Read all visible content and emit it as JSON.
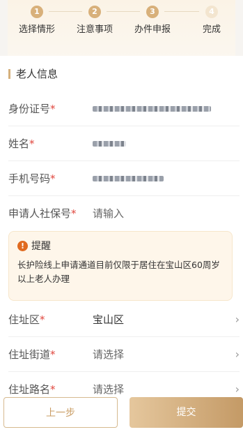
{
  "steps": [
    {
      "num": "1",
      "label": "选择情形"
    },
    {
      "num": "2",
      "label": "注意事项"
    },
    {
      "num": "3",
      "label": "办件申报"
    },
    {
      "num": "4",
      "label": "完成"
    }
  ],
  "section": {
    "title": "老人信息"
  },
  "fields": [
    {
      "label": "身份证号",
      "required_mark": "*",
      "value": ""
    },
    {
      "label": "姓名",
      "required_mark": "*",
      "value": ""
    },
    {
      "label": "手机号码",
      "required_mark": "*",
      "value": ""
    },
    {
      "label": "申请人社保号",
      "required_mark": "*",
      "placeholder": "请输入"
    }
  ],
  "alert": {
    "icon": "!",
    "title": "提醒",
    "text": "长护险线上申请通道目前仅限于居住在宝山区60周岁以上老人办理"
  },
  "address": [
    {
      "label": "住址区",
      "required_mark": "*",
      "value": "宝山区"
    },
    {
      "label": "住址街道",
      "required_mark": "*",
      "value": "请选择"
    },
    {
      "label": "住址路名",
      "required_mark": "*",
      "value": "请选择"
    }
  ],
  "footer": {
    "prev_label": "上一步",
    "submit_label": "提交"
  },
  "colors": {
    "accent": "#d8b07a",
    "required": "#e0473e",
    "alert_icon": "#e06a1f"
  }
}
